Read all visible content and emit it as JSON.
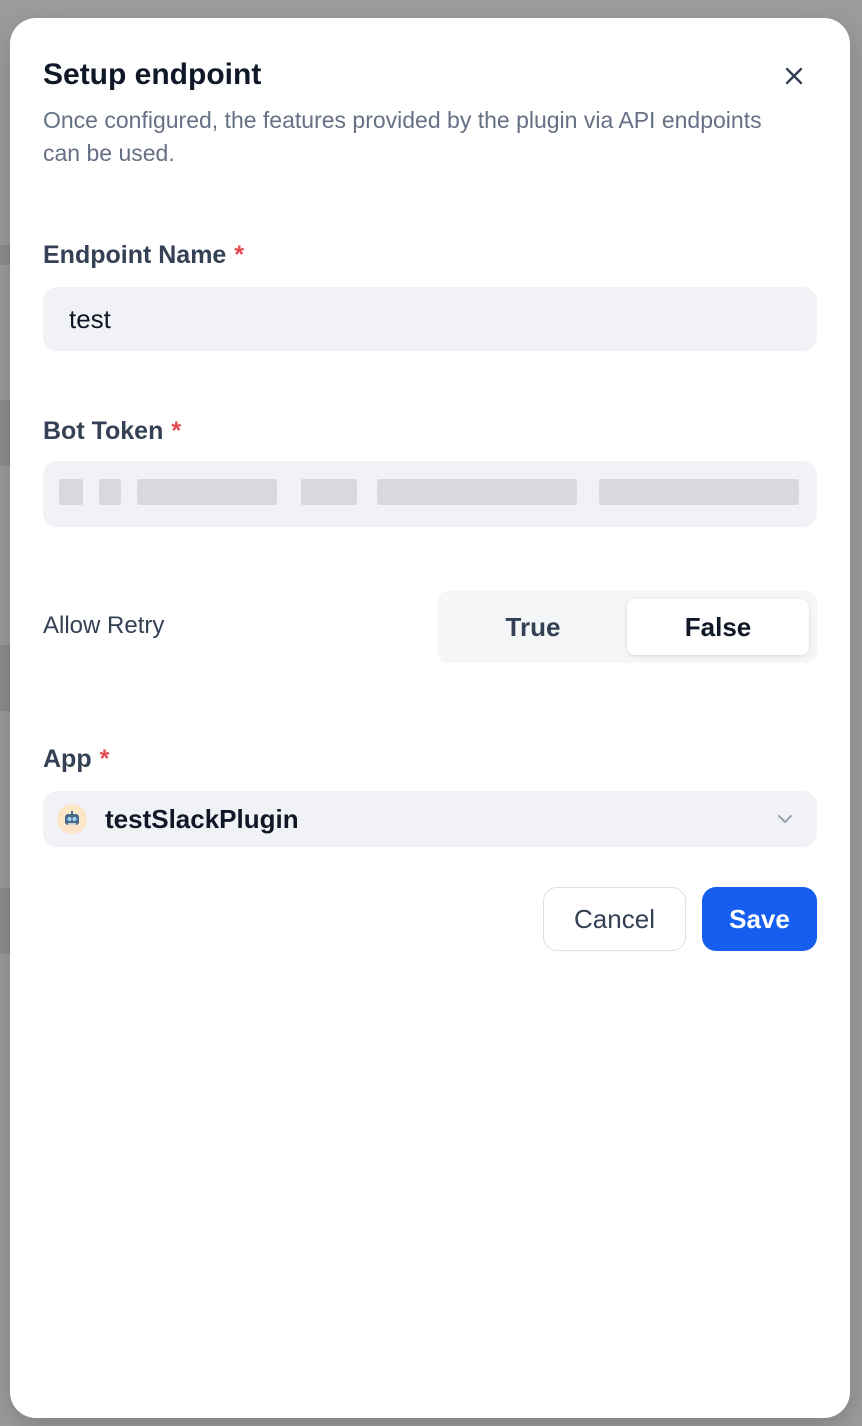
{
  "dialog": {
    "title": "Setup endpoint",
    "description": "Once configured, the features provided by the plugin via API endpoints can be used."
  },
  "fields": {
    "endpoint_name": {
      "label": "Endpoint Name",
      "required_mark": "*",
      "value": "test"
    },
    "bot_token": {
      "label": "Bot Token",
      "required_mark": "*",
      "value_obscured": true
    },
    "allow_retry": {
      "label": "Allow Retry",
      "options": [
        "True",
        "False"
      ],
      "selected": "False"
    },
    "app": {
      "label": "App",
      "required_mark": "*",
      "value": "testSlackPlugin",
      "icon": "robot-icon"
    }
  },
  "actions": {
    "cancel_label": "Cancel",
    "save_label": "Save"
  },
  "colors": {
    "primary": "#155eef",
    "required": "#e5484d",
    "input_bg": "#f1f2f5"
  }
}
